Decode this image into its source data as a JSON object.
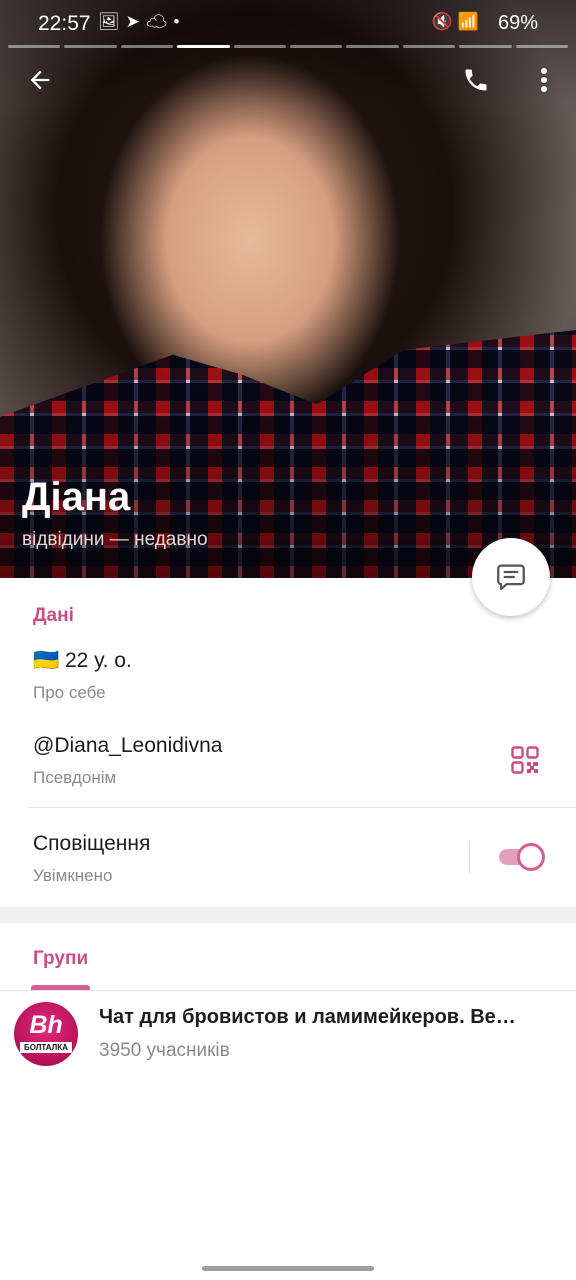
{
  "status_bar": {
    "time": "22:57",
    "left_icons": [
      "image-icon",
      "telegram-icon",
      "cloud-icon",
      "dot-icon"
    ],
    "right_icons": [
      "mute-icon",
      "wifi-icon",
      "signal-icon",
      "signal-icon"
    ],
    "battery": "69%"
  },
  "story_progress": {
    "segments": 10,
    "active_index": 3
  },
  "profile": {
    "name": "Діана",
    "last_seen": "відвідини — недавно"
  },
  "info": {
    "section_title": "Дані",
    "bio": {
      "value": "🇺🇦 22 у. о.",
      "label": "Про себе"
    },
    "username": {
      "value": "@Diana_Leonidivna",
      "label": "Псевдонім"
    },
    "notifications": {
      "value": "Сповіщення",
      "label": "Увімкнено",
      "enabled": true
    }
  },
  "tabs": {
    "groups_label": "Групи"
  },
  "groups": [
    {
      "name": "Чат для бровистов и ламимейкеров. Ве…",
      "members": "3950 учасників",
      "avatar_text": "Bh",
      "avatar_subtext": "БОЛТАЛКА"
    }
  ],
  "colors": {
    "accent": "#c94f82",
    "toggle_track": "#e3a0bd",
    "toggle_knob_border": "#d35f93"
  }
}
